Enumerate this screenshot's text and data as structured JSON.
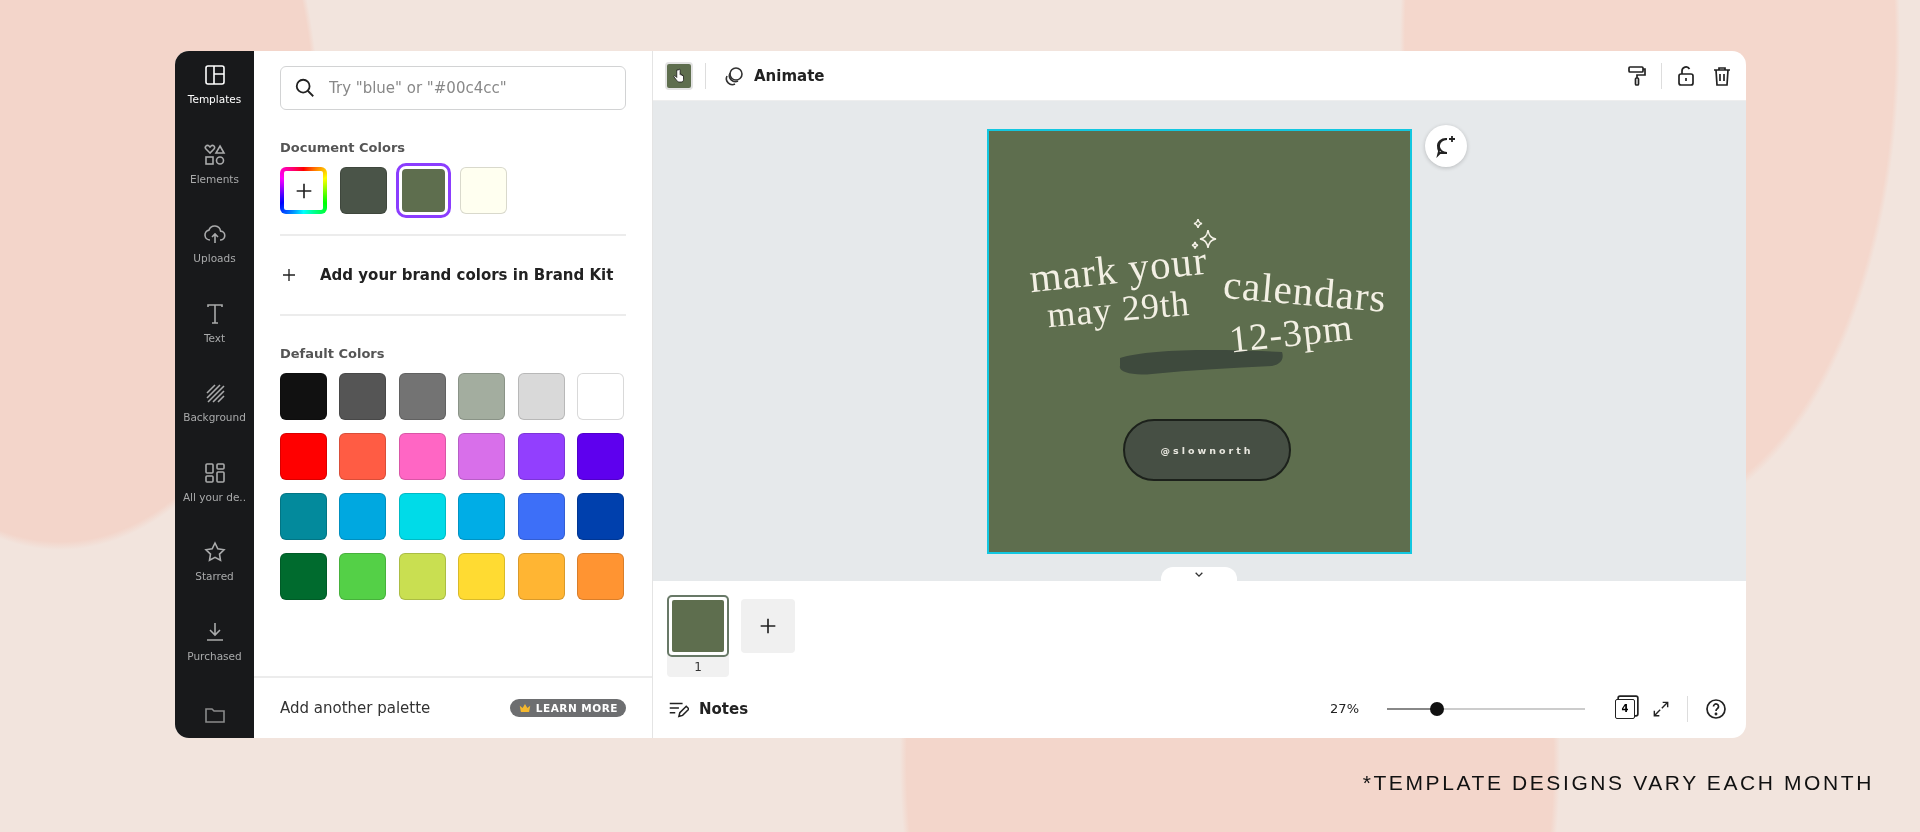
{
  "sidebar": {
    "items": [
      {
        "label": "Templates",
        "selected": true
      },
      {
        "label": "Elements",
        "selected": false
      },
      {
        "label": "Uploads",
        "selected": false
      },
      {
        "label": "Text",
        "selected": false
      },
      {
        "label": "Background",
        "selected": false
      },
      {
        "label": "All your de..",
        "selected": false
      },
      {
        "label": "Starred",
        "selected": false
      },
      {
        "label": "Purchased",
        "selected": false
      }
    ]
  },
  "color_panel": {
    "search": {
      "placeholder": "Try \"blue\" or \"#00c4cc\""
    },
    "document_colors": {
      "title": "Document Colors",
      "swatches": [
        {
          "kind": "add",
          "selected": false
        },
        {
          "kind": "swatch",
          "color": "#4a5448",
          "selected": false
        },
        {
          "kind": "swatch",
          "color": "#5e6e4e",
          "selected": true
        },
        {
          "kind": "swatch",
          "color": "#fffff0",
          "selected": false
        }
      ]
    },
    "brand_kit": {
      "label": "Add your brand colors in Brand Kit"
    },
    "default_colors": {
      "title": "Default Colors",
      "swatches": [
        {
          "color": "#111111"
        },
        {
          "color": "#555555"
        },
        {
          "color": "#737373"
        },
        {
          "color": "#a3ad9f"
        },
        {
          "color": "#d9d9d9"
        },
        {
          "color": "#ffffff"
        },
        {
          "color": "#ff0000"
        },
        {
          "color": "#ff5c44"
        },
        {
          "color": "#ff66c4"
        },
        {
          "color": "#d86fea"
        },
        {
          "color": "#923ffe"
        },
        {
          "color": "#5e00ee"
        },
        {
          "color": "#038a9c"
        },
        {
          "color": "#00a8e0"
        },
        {
          "color": "#00dbe8"
        },
        {
          "color": "#00ade6"
        },
        {
          "color": "#3d6ff8"
        },
        {
          "color": "#0040ad"
        },
        {
          "color": "#006b2e"
        },
        {
          "color": "#54d047"
        },
        {
          "color": "#c9df51"
        },
        {
          "color": "#ffdb32"
        },
        {
          "color": "#ffb533"
        },
        {
          "color": "#ff9432"
        }
      ]
    },
    "footer": {
      "label": "Add another palette",
      "badge": "LEARN MORE"
    }
  },
  "toolbar": {
    "animate": "Animate"
  },
  "design": {
    "lines": [
      "mark your",
      "calendars",
      "may 29th",
      "12-3pm"
    ],
    "handle": "@slownorth"
  },
  "pages": [
    {
      "number": "1",
      "selected": true
    }
  ],
  "bottom_bar": {
    "notes": "Notes",
    "zoom": "27%",
    "zoom_slider": {
      "level": 0.25
    },
    "page_count": "4"
  },
  "footnote": "*TEMPLATE DESIGNS VARY EACH MONTH"
}
